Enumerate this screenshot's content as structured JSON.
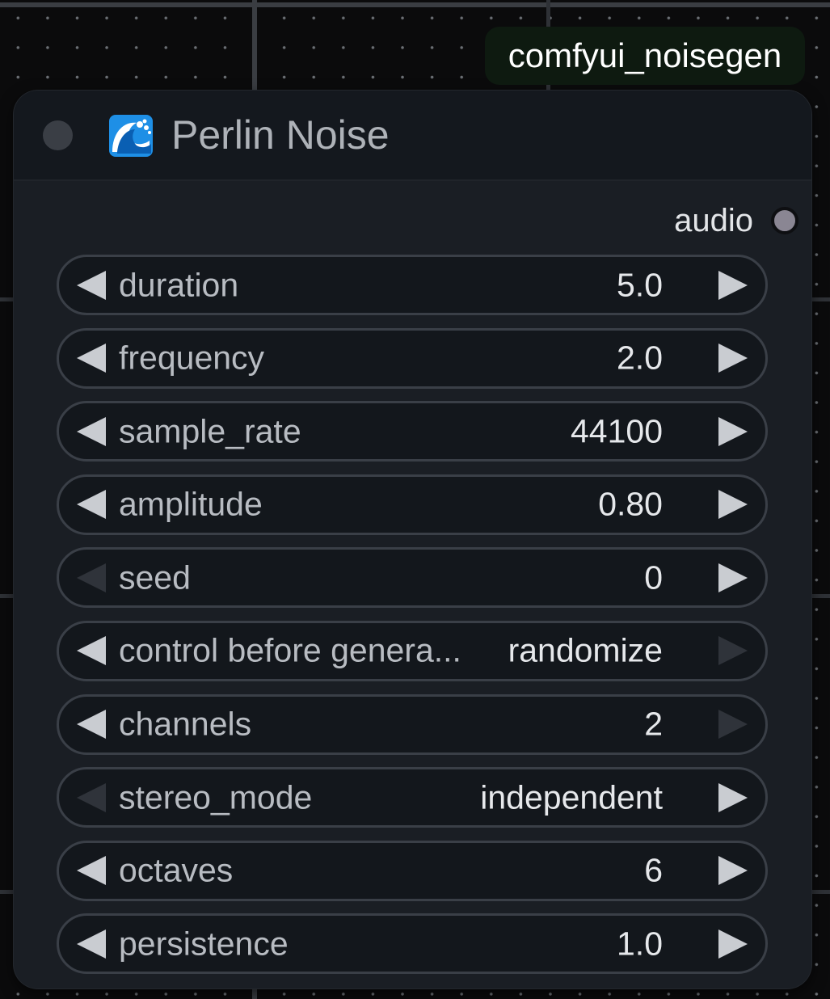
{
  "badge": {
    "text": "comfyui_noisegen"
  },
  "node": {
    "title": "Perlin Noise",
    "icon": "wave-emoji-icon",
    "output": {
      "label": "audio"
    }
  },
  "widgets": [
    {
      "label": "duration",
      "value": "5.0",
      "left_enabled": true,
      "right_enabled": true
    },
    {
      "label": "frequency",
      "value": "2.0",
      "left_enabled": true,
      "right_enabled": true
    },
    {
      "label": "sample_rate",
      "value": "44100",
      "left_enabled": true,
      "right_enabled": true
    },
    {
      "label": "amplitude",
      "value": "0.80",
      "left_enabled": true,
      "right_enabled": true
    },
    {
      "label": "seed",
      "value": "0",
      "left_enabled": false,
      "right_enabled": true
    },
    {
      "label": "control before genera...",
      "value": "randomize",
      "left_enabled": true,
      "right_enabled": false
    },
    {
      "label": "channels",
      "value": "2",
      "left_enabled": true,
      "right_enabled": false
    },
    {
      "label": "stereo_mode",
      "value": "independent",
      "left_enabled": false,
      "right_enabled": true
    },
    {
      "label": "octaves",
      "value": "6",
      "left_enabled": true,
      "right_enabled": true
    },
    {
      "label": "persistence",
      "value": "1.0",
      "left_enabled": true,
      "right_enabled": true
    }
  ],
  "colors": {
    "canvas": "#0b0b0c",
    "node_body": "#1a1e24",
    "node_header": "#14181e",
    "badge_bg": "#0e1a10",
    "output_slot": "#8a8693"
  }
}
